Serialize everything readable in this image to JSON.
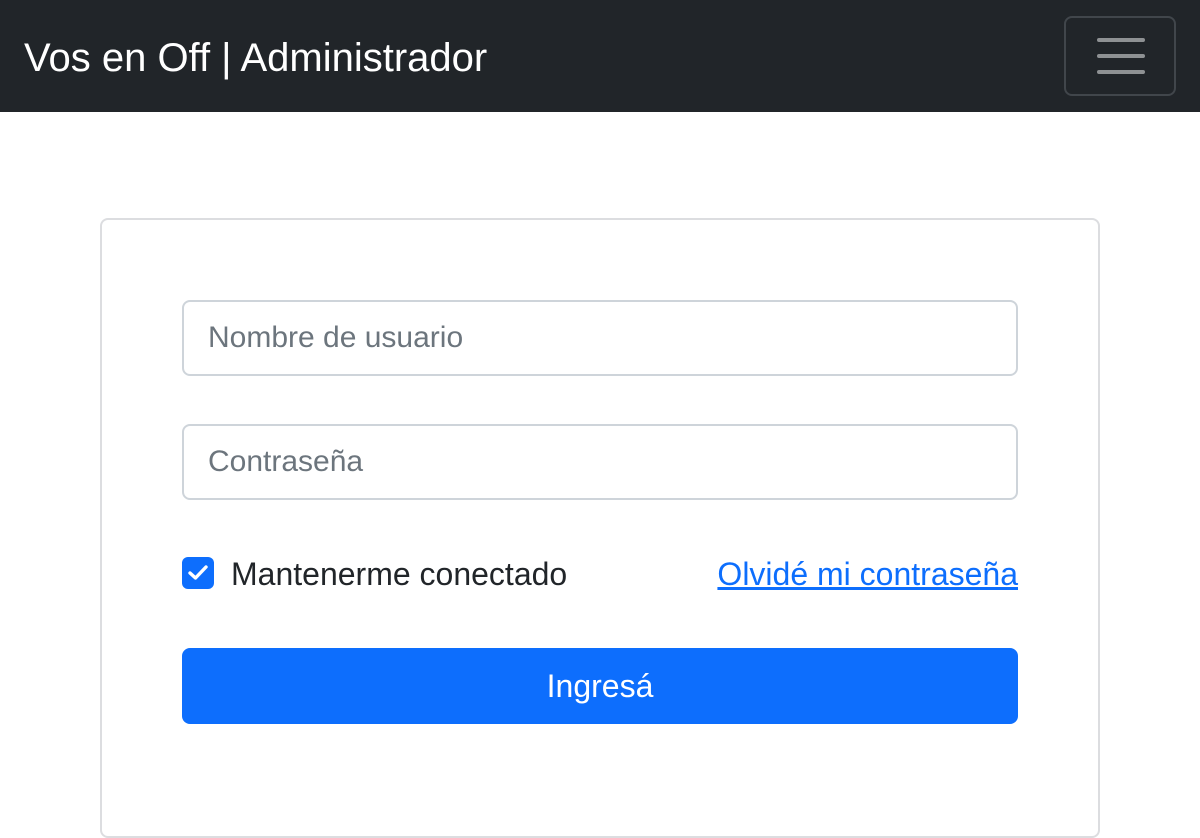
{
  "navbar": {
    "brand": "Vos en Off | Administrador",
    "menu_icon": "hamburger-menu-icon",
    "background": "#212529"
  },
  "login_form": {
    "username": {
      "value": "",
      "placeholder": "Nombre de usuario"
    },
    "password": {
      "value": "",
      "placeholder": "Contraseña"
    },
    "remember_me": {
      "label": "Mantenerme conectado",
      "checked": true,
      "icon": "checkmark-icon"
    },
    "forgot_password_link": "Olvidé mi contraseña",
    "submit_label": "Ingresá"
  },
  "colors": {
    "primary": "#0d6efd",
    "navbar": "#212529"
  }
}
